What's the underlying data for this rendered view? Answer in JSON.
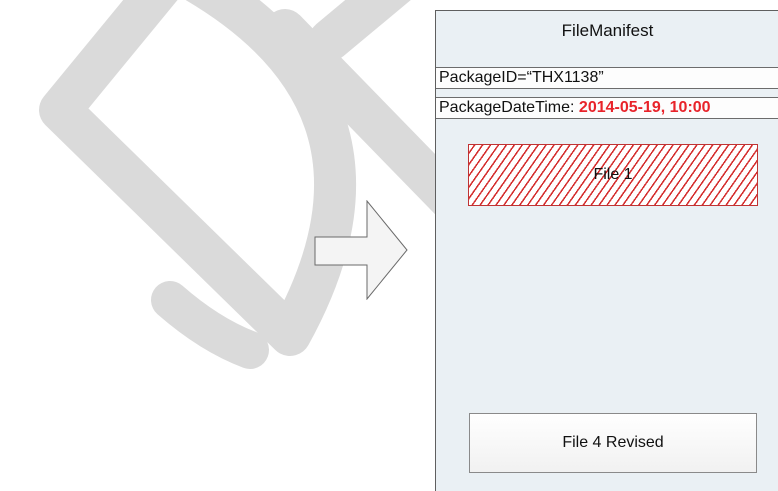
{
  "manifest": {
    "title": "FileManifest",
    "package_id_text": "PackageID=“THX1138”",
    "package_datetime_label": "PackageDateTime: ",
    "package_datetime_value": "2014-05-19, 10:00"
  },
  "files": [
    {
      "label": "File 1",
      "style": "hatched-red"
    },
    {
      "label": "File 4 Revised",
      "style": "plain"
    }
  ],
  "colors": {
    "panel": "#eaf0f4",
    "highlight": "#e8232a",
    "watermark": "#d9d9d9"
  },
  "icons": {
    "arrow": "right-arrow-icon"
  }
}
